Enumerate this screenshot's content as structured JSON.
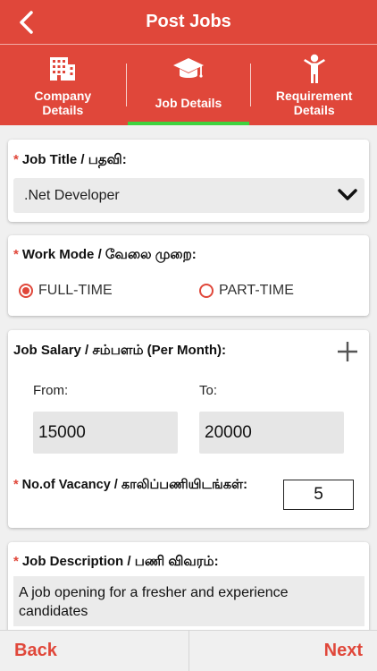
{
  "header": {
    "title": "Post Jobs"
  },
  "tabs": [
    {
      "label": "Company Details",
      "icon": "building-icon",
      "active": false
    },
    {
      "label": "Job Details",
      "icon": "graduation-cap-icon",
      "active": true
    },
    {
      "label": "Requirement Details",
      "icon": "person-icon",
      "active": false
    }
  ],
  "job_title": {
    "label": "Job Title / பதவி:",
    "value": ".Net Developer"
  },
  "work_mode": {
    "label": "Work Mode / வேலை முறை:",
    "options": [
      "FULL-TIME",
      "PART-TIME"
    ],
    "selected": "FULL-TIME"
  },
  "salary": {
    "label": "Job Salary / சம்பளம் (Per Month):",
    "from_label": "From:",
    "from_value": "15000",
    "to_label": "To:",
    "to_value": "20000"
  },
  "vacancy": {
    "label": "No.of Vacancy / காலிப்பணியிடங்கள்:",
    "value": "5"
  },
  "description": {
    "label": "Job Description / பணி விவரம்:",
    "value": "A job opening for a fresher and experience candidates"
  },
  "footer": {
    "back_label": "Back",
    "next_label": "Next"
  },
  "colors": {
    "primary": "#e0473a",
    "active_tab_underline": "#3fd23f"
  }
}
